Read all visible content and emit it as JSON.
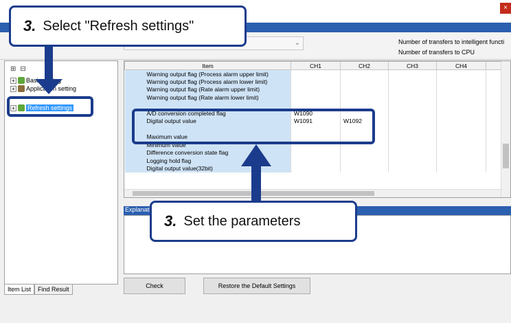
{
  "window": {
    "close_glyph": "×"
  },
  "toolbar": {
    "info_line1": "Number of transfers to intelligent functi",
    "info_line2": "Number of transfers to CPU"
  },
  "tree": {
    "items": [
      {
        "label": "Basic setting"
      },
      {
        "label": "Application setting"
      },
      {
        "label": "Refresh settings"
      }
    ]
  },
  "tabs": [
    "Item List",
    "Find Result"
  ],
  "grid": {
    "columns": [
      "Item",
      "CH1",
      "CH2",
      "CH3",
      "CH4"
    ],
    "rows": [
      {
        "item": "Warning output flag (Process alarm upper limit)",
        "ch1": "",
        "ch2": ""
      },
      {
        "item": "Warning output flag (Process alarm lower limit)",
        "ch1": "",
        "ch2": ""
      },
      {
        "item": "Warning output flag (Rate alarm upper limit)",
        "ch1": "",
        "ch2": ""
      },
      {
        "item": "Warning output flag (Rate alarm lower limit)",
        "ch1": "",
        "ch2": ""
      },
      {
        "item": "",
        "ch1": "",
        "ch2": ""
      },
      {
        "item": "A/D conversion completed flag",
        "ch1": "W1090",
        "ch2": ""
      },
      {
        "item": "Digital output value",
        "ch1": "W1091",
        "ch2": "W1092"
      },
      {
        "item": "",
        "ch1": "",
        "ch2": ""
      },
      {
        "item": "Maximum value",
        "ch1": "",
        "ch2": ""
      },
      {
        "item": "Minimum value",
        "ch1": "",
        "ch2": ""
      },
      {
        "item": "Difference conversion state flag",
        "ch1": "",
        "ch2": ""
      },
      {
        "item": "Logging hold flag",
        "ch1": "",
        "ch2": ""
      },
      {
        "item": "Digital output value(32bit)",
        "ch1": "",
        "ch2": ""
      }
    ]
  },
  "explanation": {
    "title": "Explanation"
  },
  "buttons": {
    "check": "Check",
    "restore": "Restore the Default Settings"
  },
  "callouts": {
    "top": {
      "num": "3.",
      "text": "Select \"Refresh settings\""
    },
    "bottom": {
      "num": "3.",
      "text": "Set the parameters"
    }
  },
  "colors": {
    "accent": "#1b3c8c",
    "selection": "#3399ff",
    "item_bg": "#cfe3f6"
  }
}
